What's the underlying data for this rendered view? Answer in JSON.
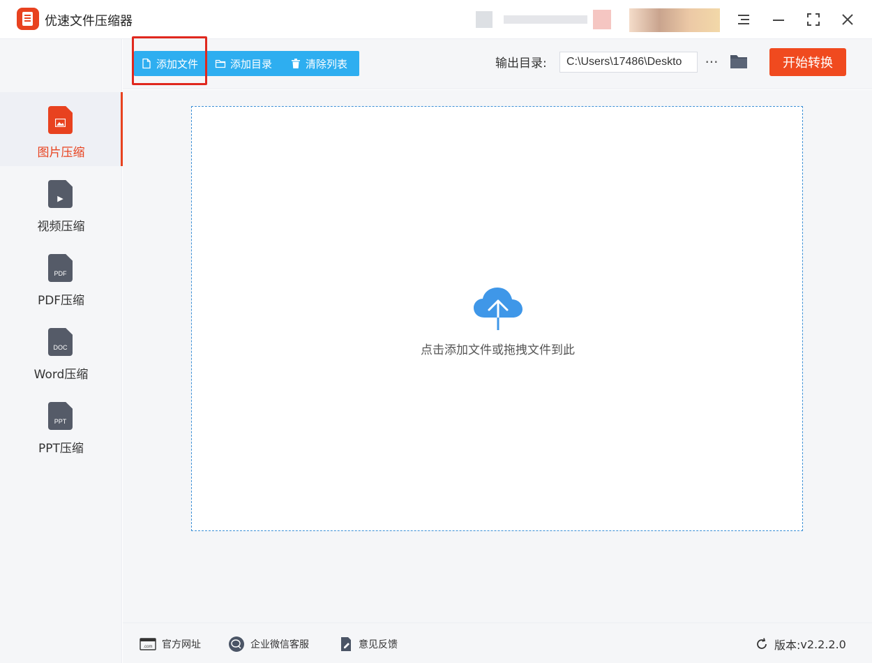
{
  "window": {
    "title": "优速文件压缩器"
  },
  "sidebar": {
    "items": [
      {
        "label": "图片压缩",
        "icon": "image-file-icon",
        "glyph": "",
        "active": true
      },
      {
        "label": "视频压缩",
        "icon": "video-file-icon",
        "glyph": "▶",
        "active": false
      },
      {
        "label": "PDF压缩",
        "icon": "pdf-file-icon",
        "glyph": "PDF",
        "active": false
      },
      {
        "label": "Word压缩",
        "icon": "doc-file-icon",
        "glyph": "DOC",
        "active": false
      },
      {
        "label": "PPT压缩",
        "icon": "ppt-file-icon",
        "glyph": "PPT",
        "active": false
      }
    ]
  },
  "toolbar": {
    "add_file": "添加文件",
    "add_folder": "添加目录",
    "clear_list": "清除列表",
    "output_label": "输出目录:",
    "output_path": "C:\\Users\\17486\\Deskto",
    "more": "···",
    "start": "开始转换"
  },
  "dropzone": {
    "hint": "点击添加文件或拖拽文件到此"
  },
  "footer": {
    "website": "官方网址",
    "wechat_service": "企业微信客服",
    "feedback": "意见反馈",
    "version_label": "版本:",
    "version": "v2.2.2.0"
  },
  "colors": {
    "accent": "#e8421f",
    "toolbar_button": "#2eaef0",
    "start_button": "#f04a1f",
    "highlight": "#e0281e",
    "cloud": "#3f97e8"
  }
}
